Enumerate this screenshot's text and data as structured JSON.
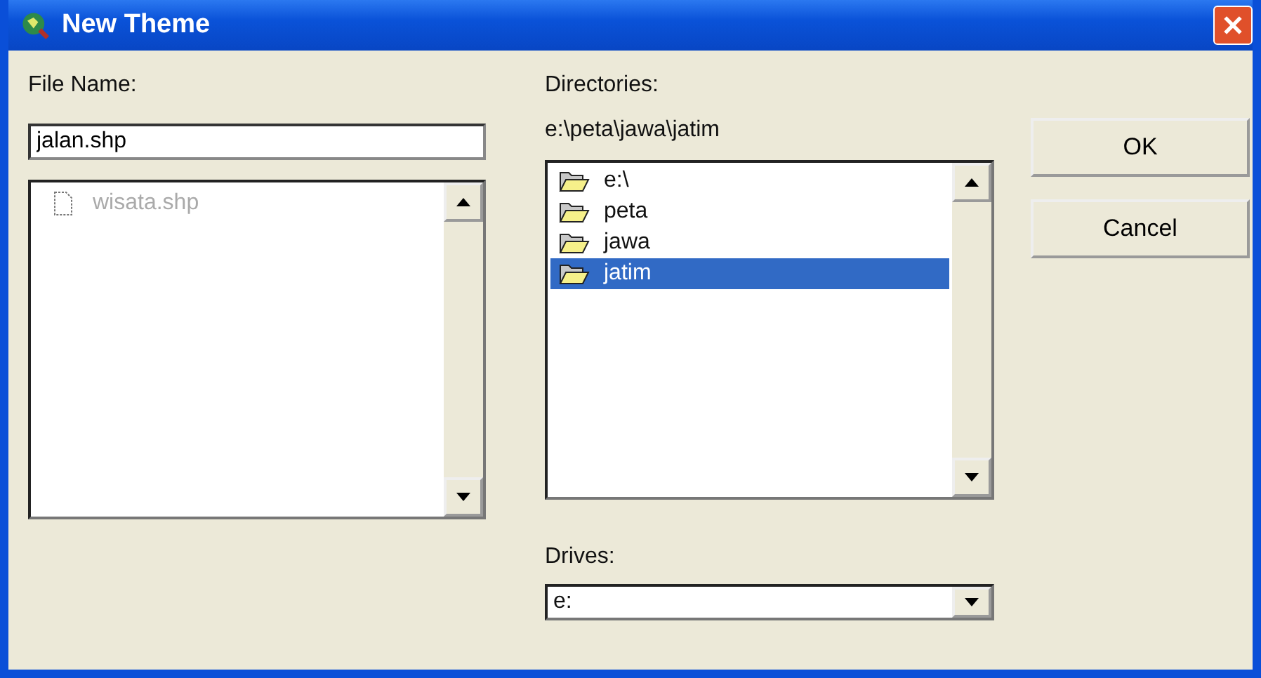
{
  "window": {
    "title": "New Theme"
  },
  "file_name": {
    "label": "File Name:",
    "value": "jalan.shp"
  },
  "files": [
    {
      "name": "wisata.shp",
      "disabled": true
    }
  ],
  "directories": {
    "label": "Directories:",
    "path": "e:\\peta\\jawa\\jatim",
    "items": [
      {
        "name": "e:\\",
        "selected": false
      },
      {
        "name": "peta",
        "selected": false
      },
      {
        "name": "jawa",
        "selected": false
      },
      {
        "name": "jatim",
        "selected": true
      }
    ]
  },
  "drives": {
    "label": "Drives:",
    "value": "e:"
  },
  "buttons": [
    "OK",
    "Cancel"
  ]
}
